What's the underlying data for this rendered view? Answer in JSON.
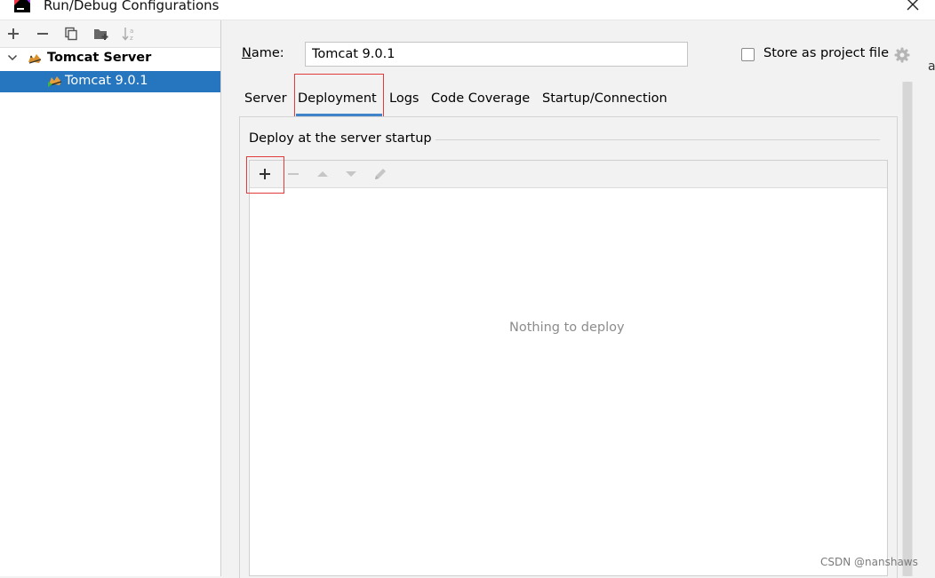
{
  "window": {
    "title": "Run/Debug Configurations"
  },
  "left_toolbar": {
    "buttons": [
      "add-icon",
      "remove-icon",
      "copy-icon",
      "new-folder-icon",
      "sort-icon"
    ]
  },
  "tree": {
    "parent_label": "Tomcat Server",
    "child_label": "Tomcat 9.0.1"
  },
  "form": {
    "name_label_underlined": "N",
    "name_label_rest": "ame:",
    "name_value": "Tomcat 9.0.1",
    "store_label": "Store as project file",
    "store_checked": false
  },
  "tabs": {
    "server": "Server",
    "deployment": "Deployment",
    "logs": "Logs",
    "code_coverage": "Code Coverage",
    "startup": "Startup/Connection",
    "active": "Deployment"
  },
  "deploy": {
    "section_title": "Deploy at the server startup",
    "empty_text": "Nothing to deploy",
    "toolbar_icons": [
      "add-icon",
      "remove-icon",
      "move-up-icon",
      "move-down-icon",
      "edit-icon"
    ]
  },
  "watermark": "CSDN @nanshaws",
  "edge_fragment": "a",
  "colors": {
    "selection": "#2675bf",
    "tab_underline": "#4083c9",
    "annotation_box": "#e23b3b"
  }
}
